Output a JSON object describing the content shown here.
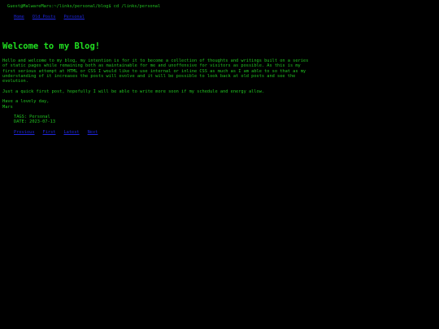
{
  "terminal": {
    "prompt": "Guest@MalwareMars:~/links/personal/blog$ cd /links/personal"
  },
  "top_nav": {
    "items": [
      {
        "label": "Home"
      },
      {
        "label": "Old Posts"
      },
      {
        "label": "Personal"
      }
    ]
  },
  "post": {
    "title": "Welcome to my Blog!",
    "paragraphs": [
      "Hello and welcome to my blog, my intention is for it to become a collection of thoughts and writings built on a series of static pages while remaining both as maintainable for me and unoffensive for visitors as possible. As this is my first serious attempt at HTML or CSS I would like to use internal or inline CSS as much as I am able to so that as my understanding of it increases the posts will evolve and it will be possible to look back at old posts and see the evolution.",
      "Just a quick first post, hopefully I will be able to write more soon if my schedule and energy allow.",
      "Have a lovely day,\nMars"
    ],
    "tags_label": "TAGS: Personal",
    "date_label": "DATE: 2023-07-13"
  },
  "bottom_nav": {
    "items": [
      {
        "label": "Previous"
      },
      {
        "label": "First"
      },
      {
        "label": "Latest"
      },
      {
        "label": "Next"
      }
    ]
  },
  "colors": {
    "background": "#000000",
    "text": "#21c421",
    "heading": "#21e021",
    "link": "#1f27e0"
  }
}
